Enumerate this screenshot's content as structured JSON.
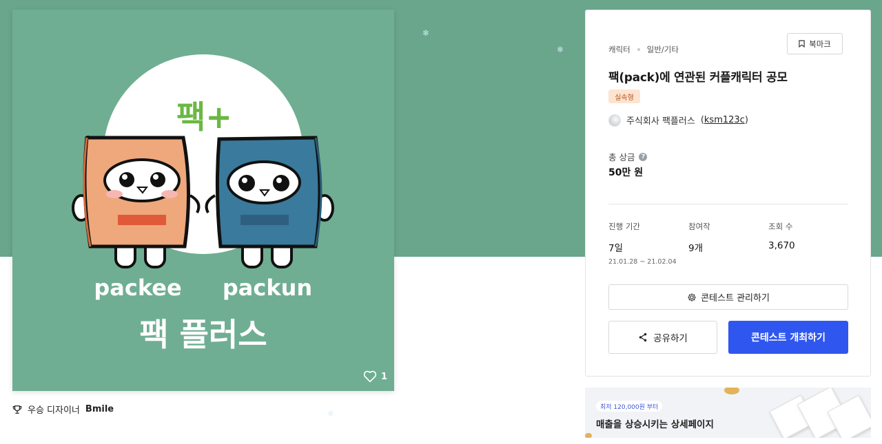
{
  "artwork": {
    "brand_logo": "팩+",
    "left_character": "packee",
    "right_character": "packun",
    "brand_name": "팩 플러스",
    "like_count": "1",
    "colors": {
      "background": "#6fae92",
      "packee": "#eea87b",
      "packun": "#3a7a9c",
      "logo_green": "#6ab842"
    }
  },
  "designer": {
    "prefix": "우승 디자이너",
    "name": "Bmile"
  },
  "panel": {
    "category": "캐릭터",
    "subcategory": "일반/기타",
    "bookmark_label": "북마크",
    "title": "팩(pack)에 연관된 커플캐릭터 공모",
    "badge": "실속형",
    "host_name": "주식회사 팩플러스",
    "host_id": "ksm123c",
    "prize_label": "총 상금",
    "prize_value": "50만 원",
    "stats": [
      {
        "label": "진행 기간",
        "value": "7일",
        "sub": "21.01.28 ~ 21.02.04"
      },
      {
        "label": "참여작",
        "value": "9개"
      },
      {
        "label": "조회 수",
        "value": "3,670"
      }
    ],
    "manage_label": "콘테스트 관리하기",
    "share_label": "공유하기",
    "host_button_label": "콘테스트 개최하기",
    "accent_color": "#2f57f0"
  },
  "ad": {
    "tag": "최저 120,000원 부터",
    "text": "매출을 상승시키는 상세페이지"
  }
}
